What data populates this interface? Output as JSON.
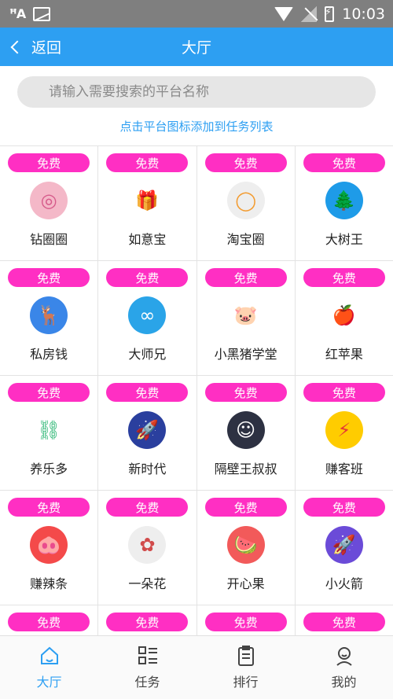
{
  "status": {
    "time": "10:03"
  },
  "nav": {
    "back_label": "返回",
    "title": "大厅"
  },
  "search": {
    "placeholder": "请输入需要搜索的平台名称"
  },
  "hint": "点击平台图标添加到任务列表",
  "badge_label": "免费",
  "apps": [
    {
      "name": "钻圈圈",
      "icon": "swirl-icon",
      "color": "#f4b8c8"
    },
    {
      "name": "如意宝",
      "icon": "gift-icon",
      "color": "#ffffff"
    },
    {
      "name": "淘宝圈",
      "icon": "rainbow-ring-icon",
      "color": "#eeeeee"
    },
    {
      "name": "大树王",
      "icon": "tree-icon",
      "color": "#1e9be8"
    },
    {
      "name": "私房钱",
      "icon": "deer-icon",
      "color": "#3a86e8"
    },
    {
      "name": "大师兄",
      "icon": "goggles-icon",
      "color": "#2aa4e8"
    },
    {
      "name": "小黑猪学堂",
      "icon": "black-pig-icon",
      "color": "#ffffff"
    },
    {
      "name": "红苹果",
      "icon": "apple-icon",
      "color": "#ffffff"
    },
    {
      "name": "养乐多",
      "icon": "green-link-icon",
      "color": "#ffffff"
    },
    {
      "name": "新时代",
      "icon": "rocket-planet-icon",
      "color": "#2a3f9e"
    },
    {
      "name": "隔壁王叔叔",
      "icon": "bearded-man-icon",
      "color": "#2d3142"
    },
    {
      "name": "赚客班",
      "icon": "pikachu-icon",
      "color": "#ffcc00"
    },
    {
      "name": "赚辣条",
      "icon": "pig-face-icon",
      "color": "#f44a4a"
    },
    {
      "name": "一朵花",
      "icon": "flower-icon",
      "color": "#eeeeee"
    },
    {
      "name": "开心果",
      "icon": "fruit-icon",
      "color": "#f25a5a"
    },
    {
      "name": "小火箭",
      "icon": "rocket-icon",
      "color": "#6b4bd8"
    },
    {
      "name": "",
      "icon": "",
      "color": "#ffffff"
    },
    {
      "name": "",
      "icon": "",
      "color": "#ffffff"
    },
    {
      "name": "",
      "icon": "",
      "color": "#ffffff"
    },
    {
      "name": "",
      "icon": "",
      "color": "#ffffff"
    }
  ],
  "tabs": [
    {
      "label": "大厅",
      "icon": "home-icon",
      "active": true
    },
    {
      "label": "任务",
      "icon": "list-icon",
      "active": false
    },
    {
      "label": "排行",
      "icon": "clipboard-icon",
      "active": false
    },
    {
      "label": "我的",
      "icon": "user-icon",
      "active": false
    }
  ],
  "colors": {
    "primary": "#2d9ff2",
    "badge": "#ff2fc3"
  }
}
